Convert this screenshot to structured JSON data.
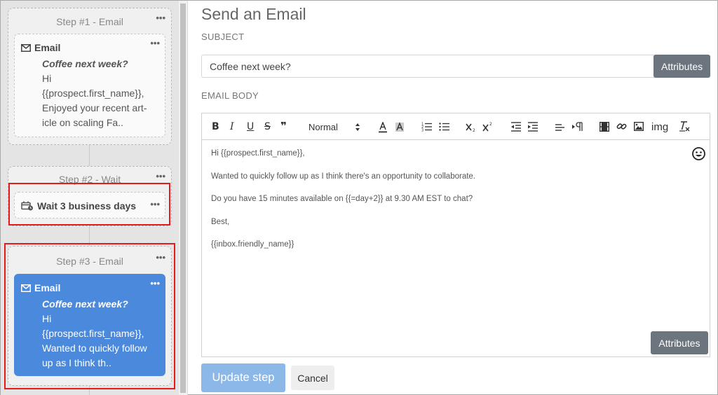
{
  "sequence": {
    "steps": [
      {
        "title": "Step #1 - Email",
        "card_type": "Email",
        "subject": "Coffee next week?",
        "preview_lines": [
          "Hi",
          "{{prospect.first_name}},",
          "Enjoyed your recent art-",
          "icle on scaling Fa.."
        ]
      },
      {
        "title": "Step #2 - Wait",
        "card_text": "Wait 3 business days"
      },
      {
        "title": "Step #3 - Email",
        "card_type": "Email",
        "subject": "Coffee next week?",
        "preview_lines": [
          "Hi",
          "{{prospect.first_name}},",
          "Wanted to quickly follow",
          "up as I think th.."
        ]
      }
    ],
    "menu_glyph": "•••"
  },
  "editor": {
    "title": "Send an Email",
    "subject_label": "SUBJECT",
    "subject_value": "Coffee next week?",
    "attributes_label": "Attributes",
    "body_label": "EMAIL BODY",
    "toolbar": {
      "bold": "B",
      "italic": "I",
      "underline": "U",
      "strike": "S",
      "quote": "❞",
      "heading_select": "Normal",
      "img": "img"
    },
    "body_lines": [
      "Hi {{prospect.first_name}},",
      "Wanted to quickly follow up as I think there's an opportunity to collaborate.",
      "Do you have 15 minutes available on {{=day+2}} at 9.30 AM EST to chat?",
      "Best,",
      "{{inbox.friendly_name}}"
    ],
    "update_label": "Update step",
    "cancel_label": "Cancel"
  },
  "colors": {
    "accent": "#4a89dc",
    "highlight": "#e31b1b",
    "attributes_button": "#6c757d",
    "update_button": "#8cb8e8"
  }
}
